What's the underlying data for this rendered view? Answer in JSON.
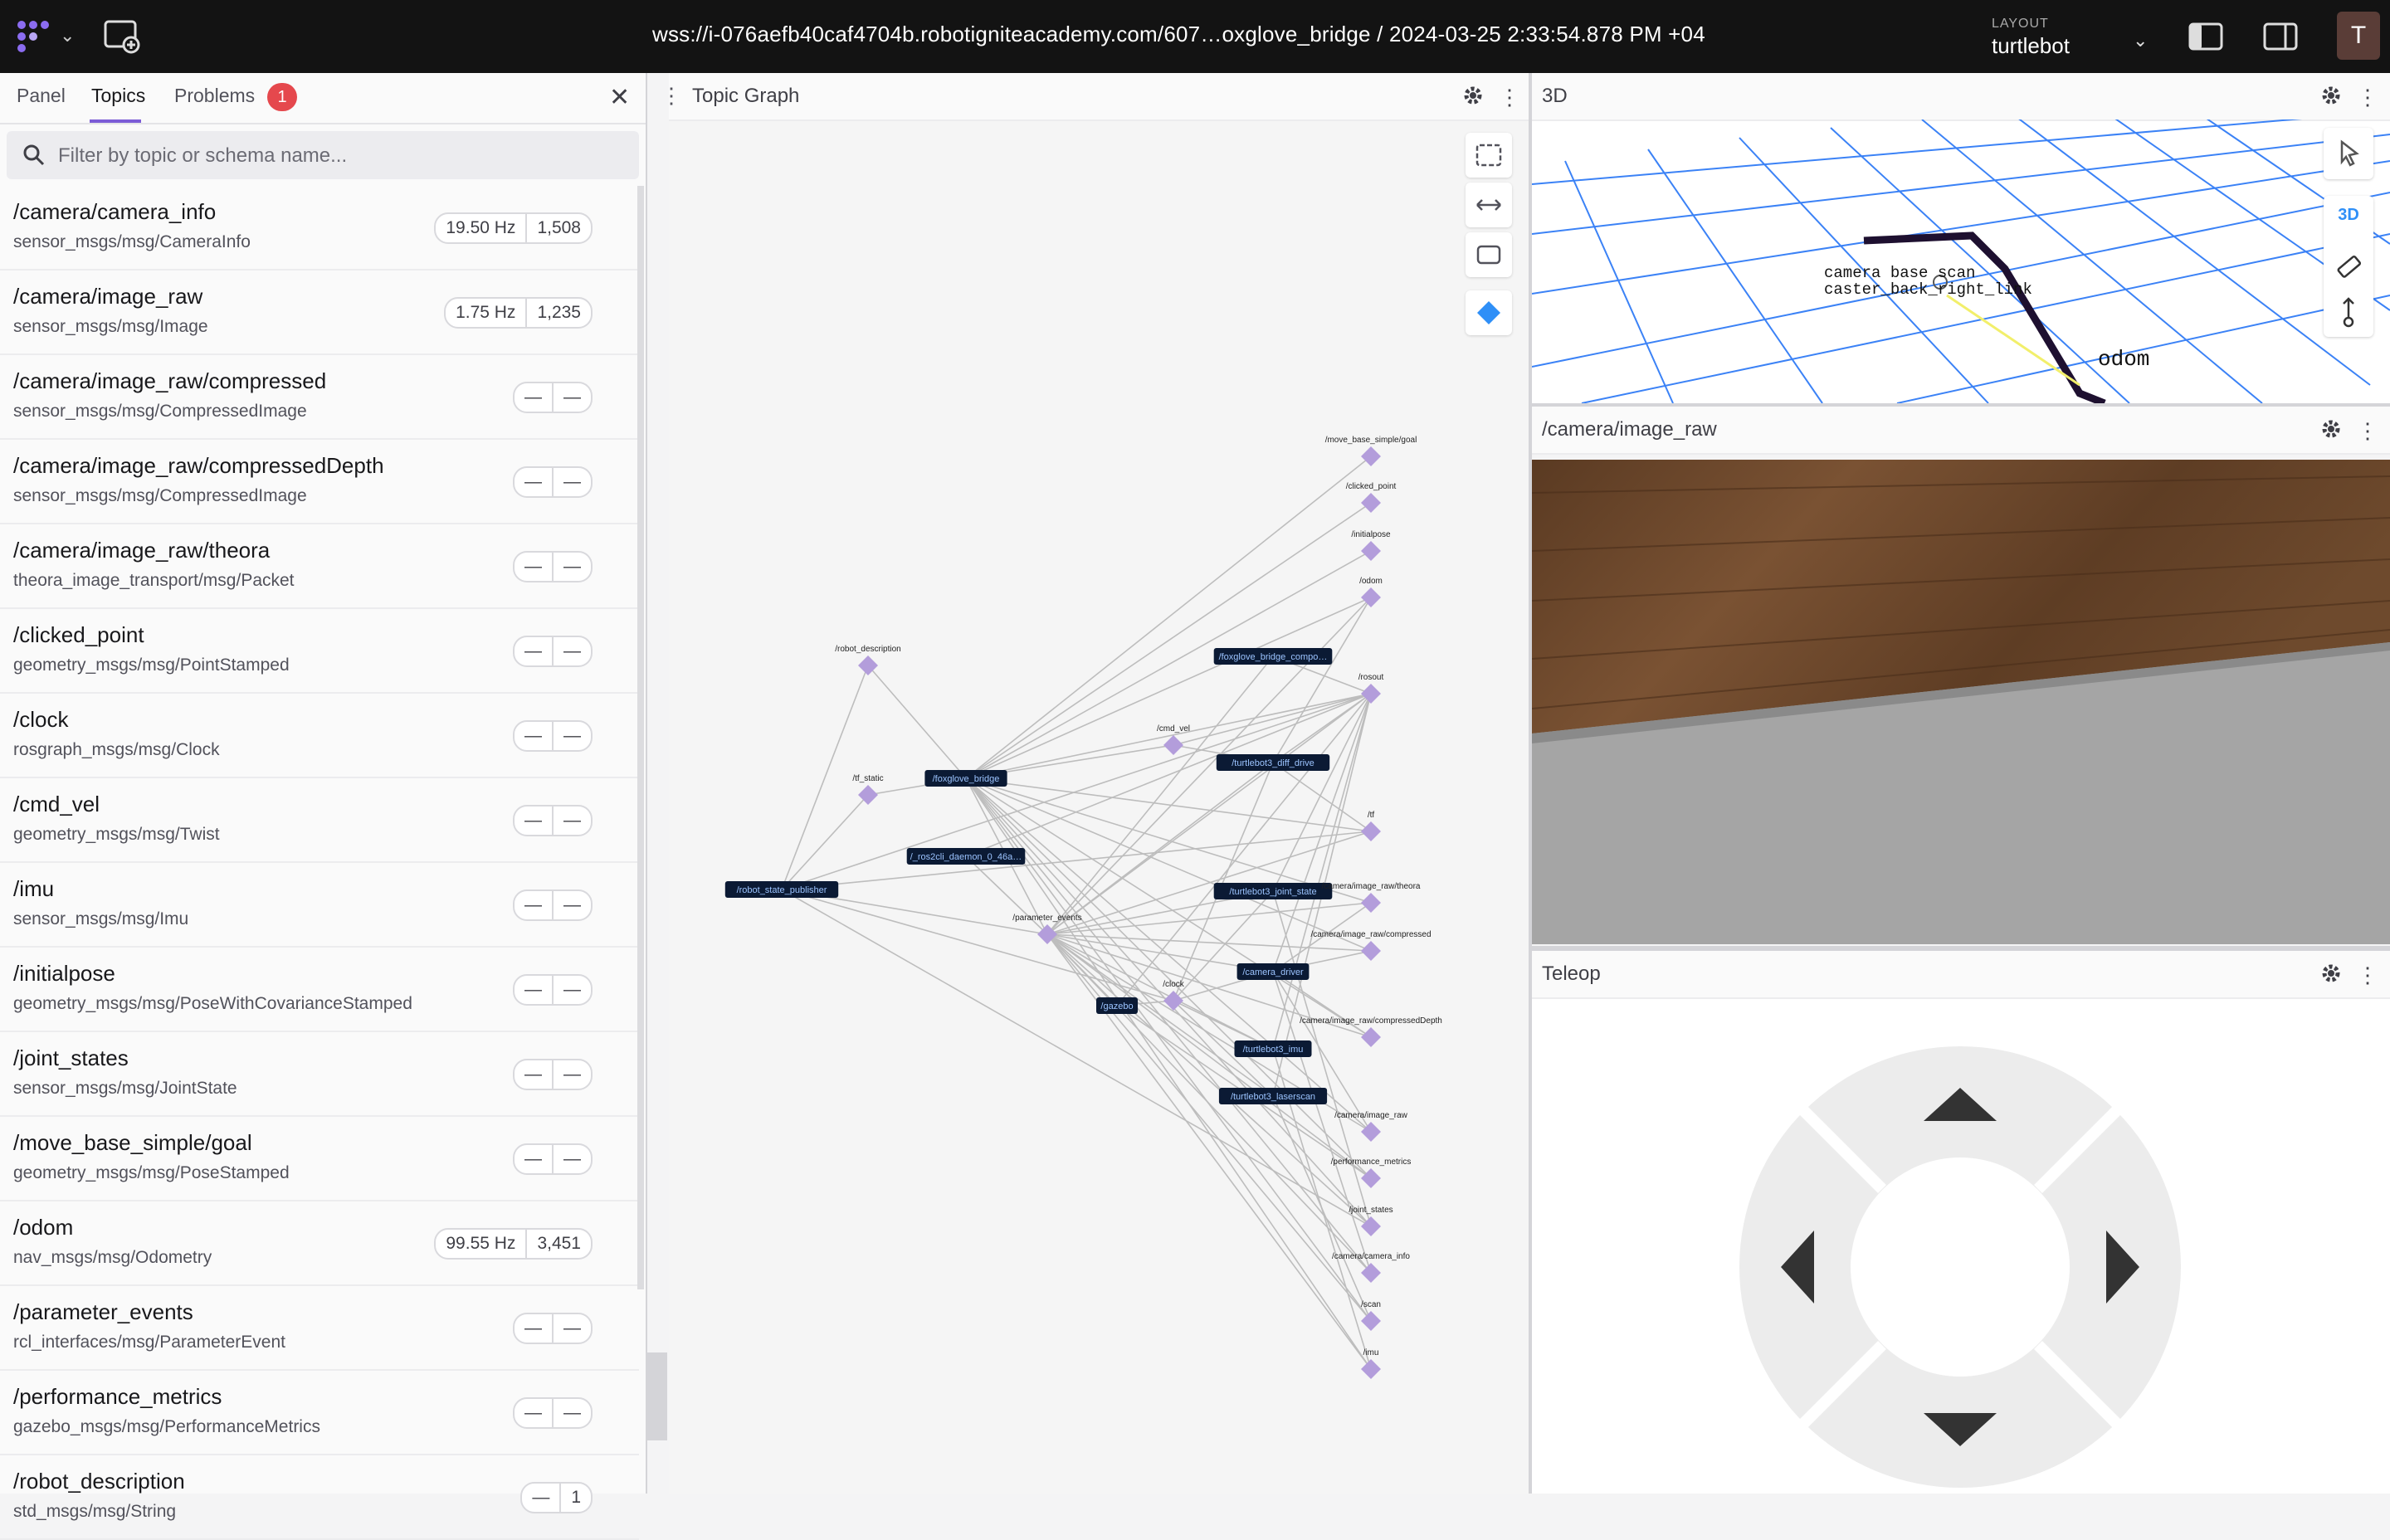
{
  "topbar": {
    "title": "wss://i-076aefb40caf4704b.robotigniteacademy.com/607…oxglove_bridge / 2024-03-25 2:33:54.878 PM +04",
    "layout_label": "LAYOUT",
    "layout_name": "turtlebot",
    "avatar_initial": "T"
  },
  "sidebar": {
    "tabs": [
      {
        "label": "Panel"
      },
      {
        "label": "Topics"
      },
      {
        "label": "Problems"
      }
    ],
    "problems_count": "1",
    "search_placeholder": "Filter by topic or schema name...",
    "topics": [
      {
        "name": "/camera/camera_info",
        "schema": "sensor_msgs/msg/CameraInfo",
        "hz": "19.50 Hz",
        "count": "1,508"
      },
      {
        "name": "/camera/image_raw",
        "schema": "sensor_msgs/msg/Image",
        "hz": "1.75 Hz",
        "count": "1,235"
      },
      {
        "name": "/camera/image_raw/compressed",
        "schema": "sensor_msgs/msg/CompressedImage",
        "hz": "—",
        "count": "—"
      },
      {
        "name": "/camera/image_raw/compressedDepth",
        "schema": "sensor_msgs/msg/CompressedImage",
        "hz": "—",
        "count": "—"
      },
      {
        "name": "/camera/image_raw/theora",
        "schema": "theora_image_transport/msg/Packet",
        "hz": "—",
        "count": "—"
      },
      {
        "name": "/clicked_point",
        "schema": "geometry_msgs/msg/PointStamped",
        "hz": "—",
        "count": "—"
      },
      {
        "name": "/clock",
        "schema": "rosgraph_msgs/msg/Clock",
        "hz": "—",
        "count": "—"
      },
      {
        "name": "/cmd_vel",
        "schema": "geometry_msgs/msg/Twist",
        "hz": "—",
        "count": "—"
      },
      {
        "name": "/imu",
        "schema": "sensor_msgs/msg/Imu",
        "hz": "—",
        "count": "—"
      },
      {
        "name": "/initialpose",
        "schema": "geometry_msgs/msg/PoseWithCovarianceStamped",
        "hz": "—",
        "count": "—"
      },
      {
        "name": "/joint_states",
        "schema": "sensor_msgs/msg/JointState",
        "hz": "—",
        "count": "—"
      },
      {
        "name": "/move_base_simple/goal",
        "schema": "geometry_msgs/msg/PoseStamped",
        "hz": "—",
        "count": "—"
      },
      {
        "name": "/odom",
        "schema": "nav_msgs/msg/Odometry",
        "hz": "99.55 Hz",
        "count": "3,451"
      },
      {
        "name": "/parameter_events",
        "schema": "rcl_interfaces/msg/ParameterEvent",
        "hz": "—",
        "count": "—"
      },
      {
        "name": "/performance_metrics",
        "schema": "gazebo_msgs/msg/PerformanceMetrics",
        "hz": "—",
        "count": "—"
      },
      {
        "name": "/robot_description",
        "schema": "std_msgs/msg/String",
        "hz": "—",
        "count": "1"
      }
    ]
  },
  "topic_graph": {
    "title": "Topic Graph",
    "nodes": [
      {
        "id": "n_state_pub",
        "label": "/robot_state_publisher",
        "kind": "node"
      },
      {
        "id": "n_foxglove",
        "label": "/foxglove_bridge",
        "kind": "node"
      },
      {
        "id": "n_ros2cli",
        "label": "/_ros2cli_daemon_0_46a…",
        "kind": "node"
      },
      {
        "id": "n_fox_comp",
        "label": "/foxglove_bridge_compo…",
        "kind": "node"
      },
      {
        "id": "n_diff",
        "label": "/turtlebot3_diff_drive",
        "kind": "node"
      },
      {
        "id": "n_joint",
        "label": "/turtlebot3_joint_state",
        "kind": "node"
      },
      {
        "id": "n_cam",
        "label": "/camera_driver",
        "kind": "node"
      },
      {
        "id": "n_imu",
        "label": "/turtlebot3_imu",
        "kind": "node"
      },
      {
        "id": "n_laser",
        "label": "/turtlebot3_laserscan",
        "kind": "node"
      },
      {
        "id": "n_gazebo",
        "label": "/gazebo",
        "kind": "node"
      },
      {
        "id": "t_robot_desc",
        "label": "/robot_description",
        "kind": "topic"
      },
      {
        "id": "t_tf_static",
        "label": "/tf_static",
        "kind": "topic"
      },
      {
        "id": "t_param",
        "label": "/parameter_events",
        "kind": "topic"
      },
      {
        "id": "t_cmd_vel",
        "label": "/cmd_vel",
        "kind": "topic"
      },
      {
        "id": "t_clock",
        "label": "/clock",
        "kind": "topic"
      },
      {
        "id": "t_move",
        "label": "/move_base_simple/goal",
        "kind": "topic"
      },
      {
        "id": "t_clicked",
        "label": "/clicked_point",
        "kind": "topic"
      },
      {
        "id": "t_initpose",
        "label": "/initialpose",
        "kind": "topic"
      },
      {
        "id": "t_odom",
        "label": "/odom",
        "kind": "topic"
      },
      {
        "id": "t_rosout",
        "label": "/rosout",
        "kind": "topic"
      },
      {
        "id": "t_tf",
        "label": "/tf",
        "kind": "topic"
      },
      {
        "id": "t_theora",
        "label": "/camera/image_raw/theora",
        "kind": "topic"
      },
      {
        "id": "t_compressed",
        "label": "/camera/image_raw/compressed",
        "kind": "topic"
      },
      {
        "id": "t_cdepth",
        "label": "/camera/image_raw/compressedDepth",
        "kind": "topic"
      },
      {
        "id": "t_raw",
        "label": "/camera/image_raw",
        "kind": "topic"
      },
      {
        "id": "t_perf",
        "label": "/performance_metrics",
        "kind": "topic"
      },
      {
        "id": "t_joint",
        "label": "/joint_states",
        "kind": "topic"
      },
      {
        "id": "t_caminfo",
        "label": "/camera/camera_info",
        "kind": "topic"
      },
      {
        "id": "t_scan",
        "label": "/scan",
        "kind": "topic"
      },
      {
        "id": "t_imu",
        "label": "/imu",
        "kind": "topic"
      }
    ]
  },
  "panel_3d": {
    "title": "3D",
    "mode_label": "3D",
    "frame_labels": [
      "camera base scan",
      "caster_back_right_link",
      "odom"
    ]
  },
  "panel_camera": {
    "title": "/camera/image_raw"
  },
  "panel_teleop": {
    "title": "Teleop"
  },
  "colors": {
    "topbar_bg": "#131313",
    "accent": "#7c5cd6",
    "node_bg": "#0b1a34",
    "topic_diamond": "#b39ddb",
    "badge": "#e5484d"
  }
}
